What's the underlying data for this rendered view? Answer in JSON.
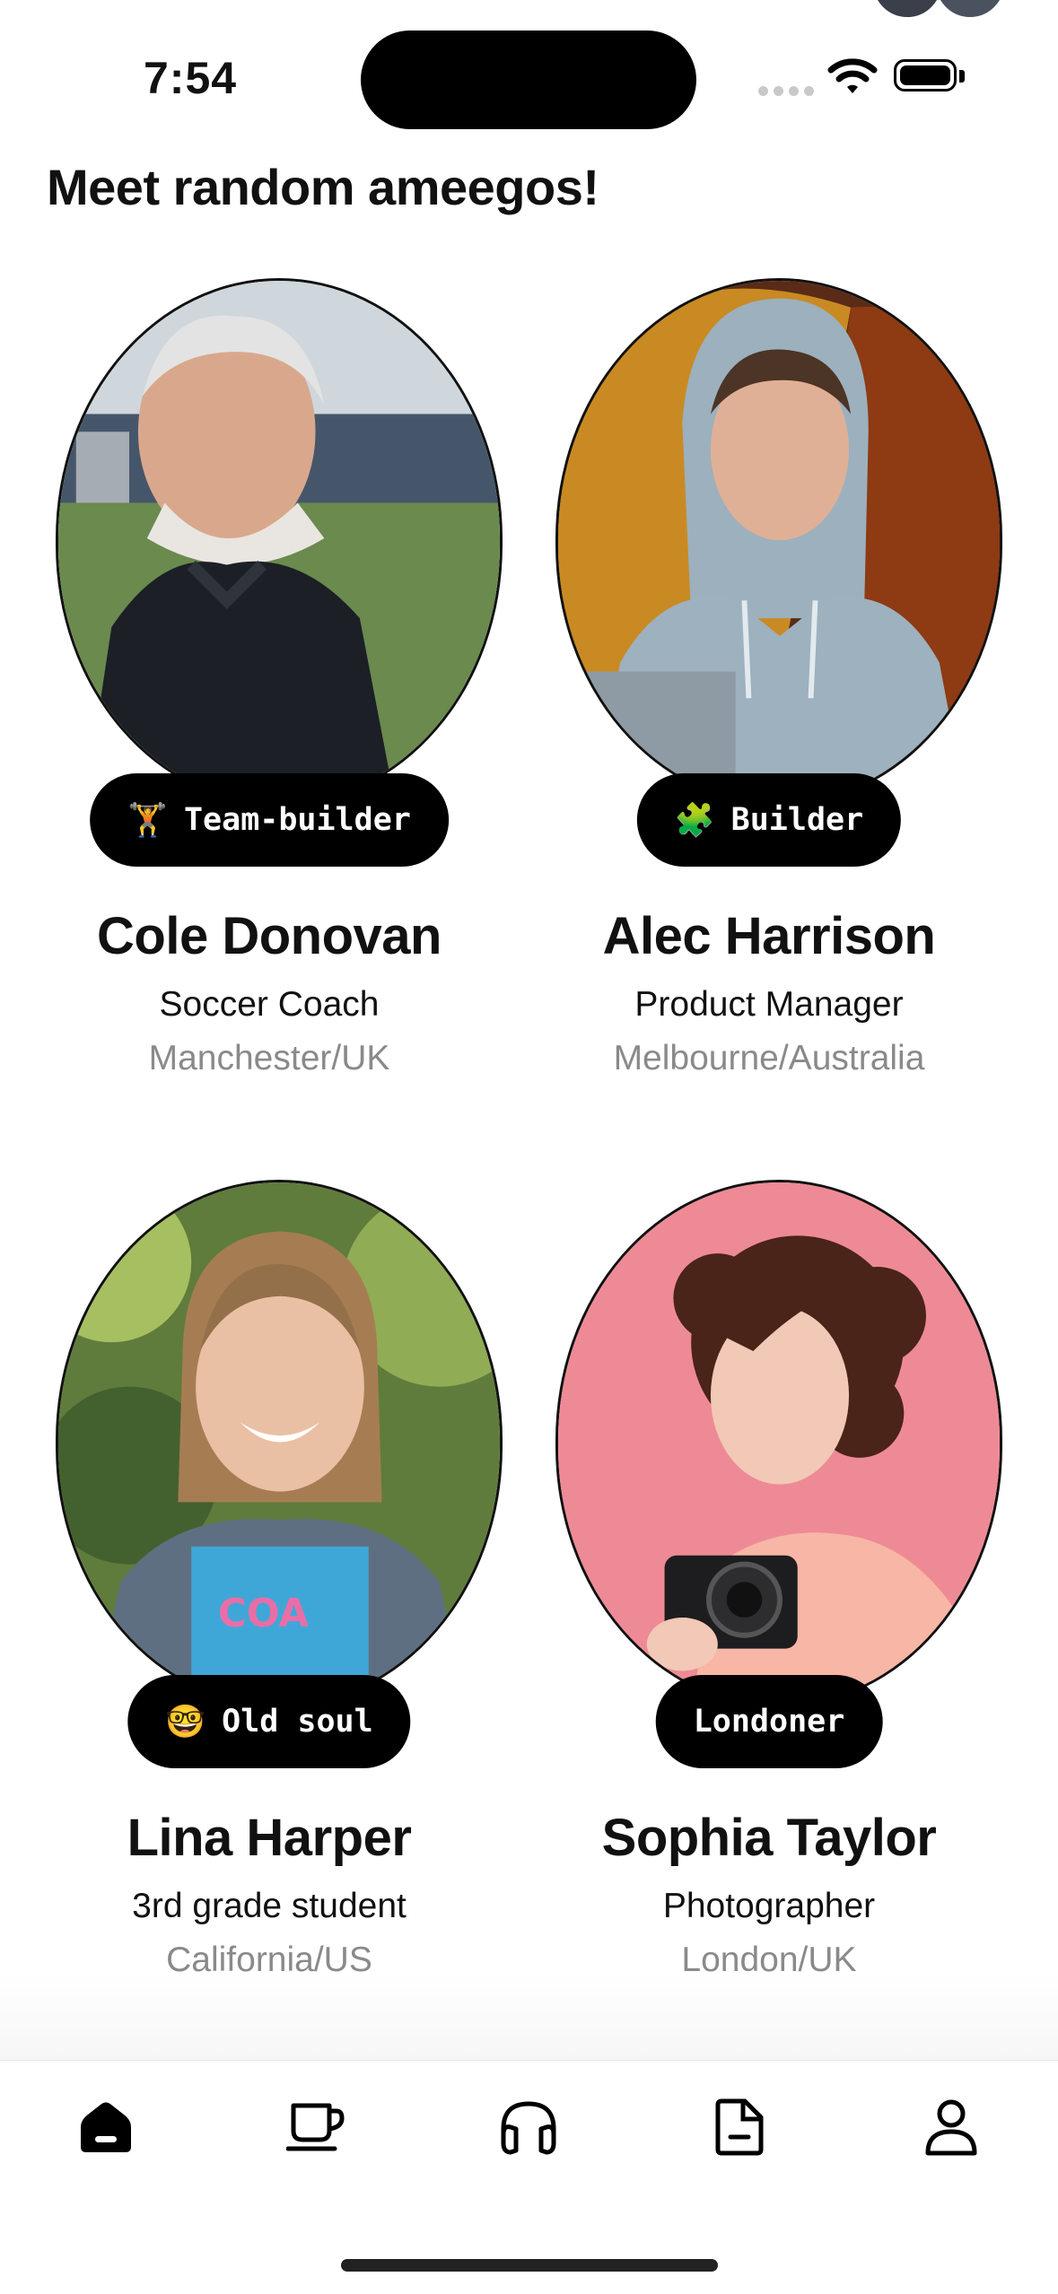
{
  "status": {
    "time": "7:54"
  },
  "header": {
    "title": "Meet random ameegos!"
  },
  "people": [
    {
      "name": "Cole Donovan",
      "role": "Soccer Coach",
      "location": "Manchester/UK",
      "badge": {
        "emoji": "🏋",
        "label": "Team-builder"
      }
    },
    {
      "name": "Alec Harrison",
      "role": "Product Manager",
      "location": "Melbourne/Australia",
      "badge": {
        "emoji": "🧩",
        "label": "Builder"
      }
    },
    {
      "name": "Lina Harper",
      "role": "3rd grade student",
      "location": "California/US",
      "badge": {
        "emoji": "🤓",
        "label": "Old soul"
      }
    },
    {
      "name": "Sophia Taylor",
      "role": "Photographer",
      "location": "London/UK",
      "badge": {
        "emoji": "",
        "label": "Londoner"
      }
    }
  ],
  "tabbar": {
    "items": [
      {
        "icon": "home-icon",
        "active": true
      },
      {
        "icon": "coffee-cup-icon",
        "active": false
      },
      {
        "icon": "headphones-icon",
        "active": false
      },
      {
        "icon": "document-icon",
        "active": false
      },
      {
        "icon": "profile-icon",
        "active": false
      }
    ]
  },
  "colors": {
    "background": "#ffffff",
    "text": "#111111",
    "muted": "#8a8a8a",
    "badge_bg": "#000000",
    "badge_text": "#ffffff"
  }
}
